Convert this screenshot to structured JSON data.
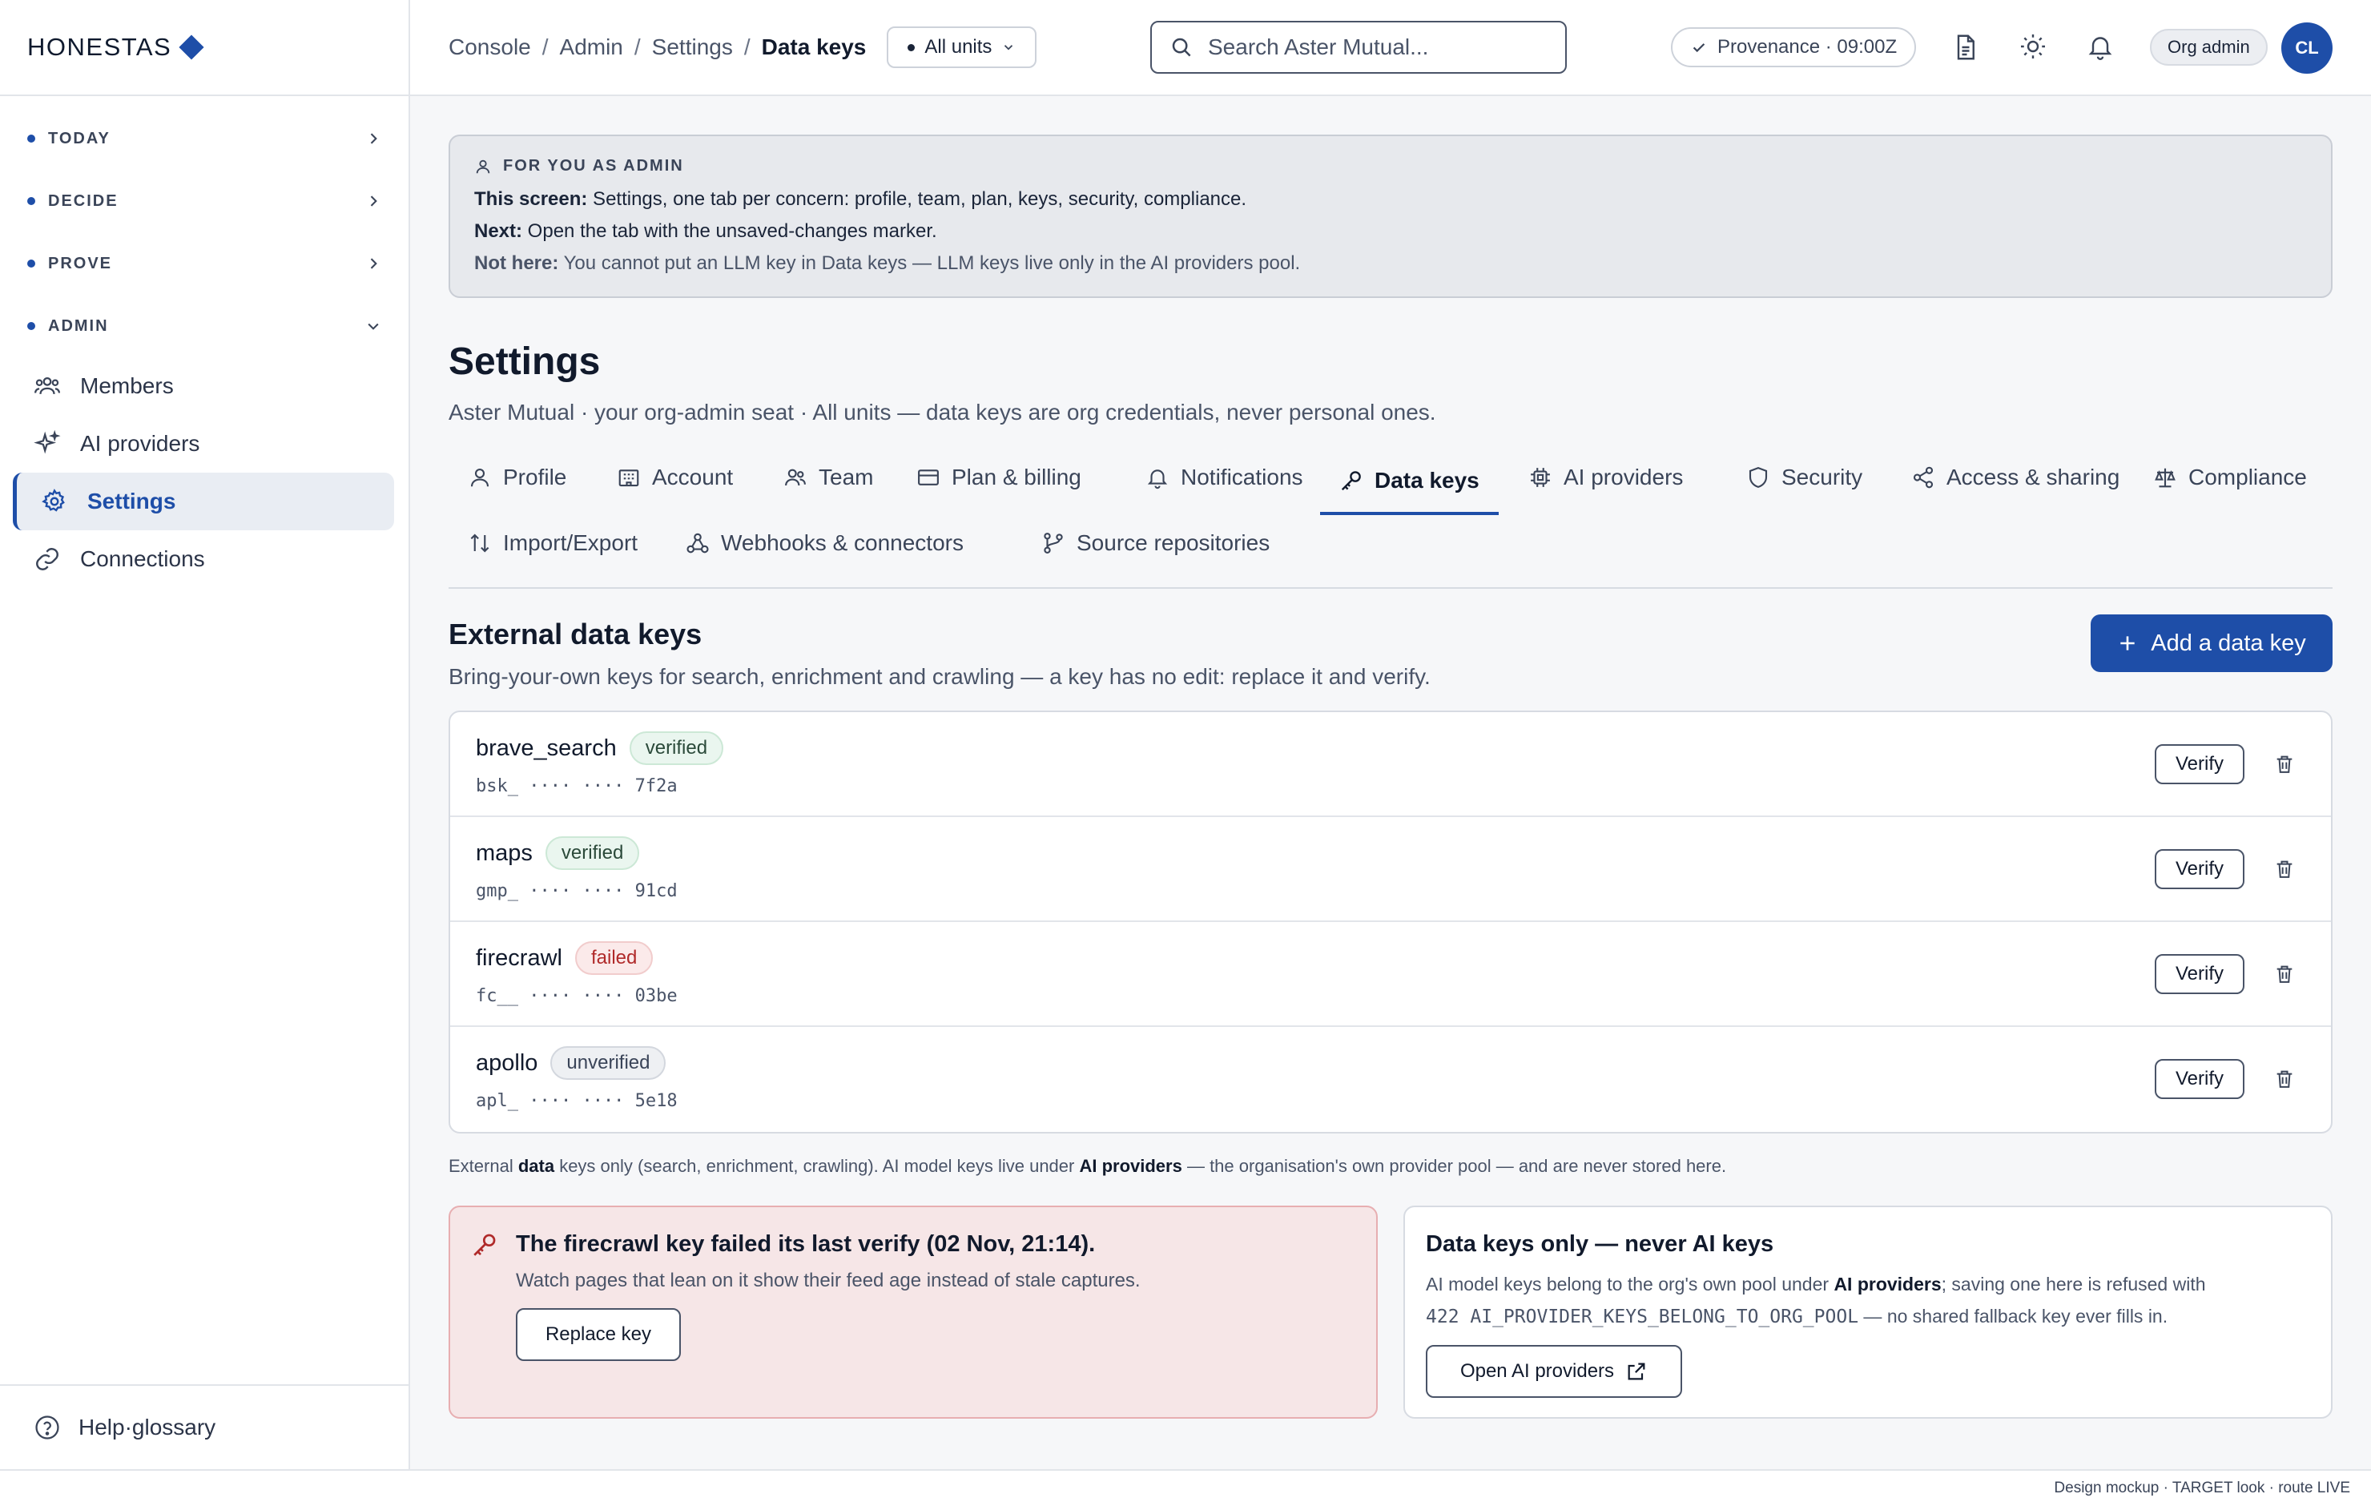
{
  "brand": {
    "name": "HONESTAS",
    "accent": "#1e4ea8"
  },
  "sidebar": {
    "groups": [
      {
        "label": "TODAY",
        "chevron": "chevron-right-icon"
      },
      {
        "label": "DECIDE",
        "chevron": "chevron-right-icon"
      },
      {
        "label": "PROVE",
        "chevron": "chevron-right-icon"
      },
      {
        "label": "ADMIN",
        "chevron": "chevron-down-icon"
      }
    ],
    "items": [
      {
        "label": "Members",
        "icon": "members-icon"
      },
      {
        "label": "AI providers",
        "icon": "sparkle-icon"
      },
      {
        "label": "Settings",
        "icon": "gear-icon",
        "active": true
      },
      {
        "label": "Connections",
        "icon": "link-icon"
      }
    ],
    "footer": {
      "label": "Help·glossary",
      "icon": "help-icon"
    }
  },
  "topbar": {
    "breadcrumb": [
      "Console",
      "Admin",
      "Settings",
      "Data keys"
    ],
    "units": "All units",
    "search_placeholder": "Search Aster Mutual...",
    "provenance": "Provenance · 09:00Z",
    "role": "Org admin",
    "avatar": "CL"
  },
  "admin_box": {
    "heading": "FOR YOU AS ADMIN",
    "screen_label": "This screen:",
    "screen_text": " Settings, one tab per concern: profile, team, plan, keys, security, compliance.",
    "next_label": "Next:",
    "next_text": " Open the tab with the unsaved-changes marker.",
    "not_label": "Not here:",
    "not_text": " You cannot put an LLM key in Data keys — LLM keys live only in the AI providers pool."
  },
  "page": {
    "title": "Settings",
    "subtitle": "Aster Mutual · your org-admin seat · All units — data keys are org credentials, never personal ones."
  },
  "tabs": [
    {
      "label": "Profile",
      "icon": "user-icon"
    },
    {
      "label": "Account",
      "icon": "building-icon"
    },
    {
      "label": "Team",
      "icon": "team-icon"
    },
    {
      "label": "Plan & billing",
      "icon": "card-icon"
    },
    {
      "label": "Notifications",
      "icon": "bell-icon"
    },
    {
      "label": "Data keys",
      "icon": "key-icon",
      "active": true
    },
    {
      "label": "AI providers",
      "icon": "chip-icon"
    },
    {
      "label": "Security",
      "icon": "shield-icon"
    },
    {
      "label": "Access & sharing",
      "icon": "share-icon"
    },
    {
      "label": "Compliance",
      "icon": "scale-icon"
    },
    {
      "label": "Import/Export",
      "icon": "arrows-icon"
    },
    {
      "label": "Webhooks & connectors",
      "icon": "webhook-icon"
    },
    {
      "label": "Source repositories",
      "icon": "branch-icon"
    }
  ],
  "section": {
    "title": "External data keys",
    "subtitle": "Bring-your-own keys for search, enrichment and crawling — a key has no edit: replace it and verify.",
    "add_label": "Add a data key"
  },
  "keys": [
    {
      "name": "brave_search",
      "status": "verified",
      "mask": "bsk_ ···· ···· 7f2a"
    },
    {
      "name": "maps",
      "status": "verified",
      "mask": "gmp_ ···· ···· 91cd"
    },
    {
      "name": "firecrawl",
      "status": "failed",
      "mask": "fc__ ···· ···· 03be"
    },
    {
      "name": "apollo",
      "status": "unverified",
      "mask": "apl_ ···· ···· 5e18"
    }
  ],
  "verify_label": "Verify",
  "footnote": {
    "p1": "External ",
    "b1": "data",
    "p2": " keys only (search, enrichment, crawling). AI model keys live under ",
    "b2": "AI providers",
    "p3": " — the organisation's own provider pool — and are never stored here."
  },
  "fail_card": {
    "title": "The firecrawl key failed its last verify (02 Nov, 21:14).",
    "subtitle": "Watch pages that lean on it show their feed age instead of stale captures.",
    "button": "Replace key"
  },
  "info_card": {
    "title": "Data keys only — never AI keys",
    "p1": "AI model keys belong to the org's own pool under ",
    "b1": "AI providers",
    "p2": "; saving one here is refused with",
    "code": "422 AI_PROVIDER_KEYS_BELONG_TO_ORG_POOL",
    "p3": " — no shared fallback key ever fills in.",
    "button": "Open AI providers"
  },
  "statusbar": "Design mockup · TARGET look · route LIVE"
}
